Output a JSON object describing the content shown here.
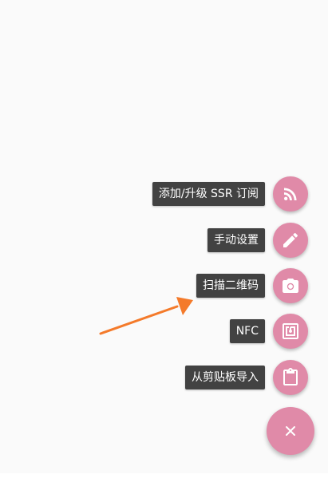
{
  "menu": {
    "items": [
      {
        "label": "添加/升级 SSR 订阅",
        "icon": "rss-icon"
      },
      {
        "label": "手动设置",
        "icon": "pencil-icon"
      },
      {
        "label": "扫描二维码",
        "icon": "camera-icon"
      },
      {
        "label": "NFC",
        "icon": "nfc-icon"
      },
      {
        "label": "从剪贴板导入",
        "icon": "clipboard-icon"
      }
    ]
  },
  "fab": {
    "icon": "close-icon"
  },
  "colors": {
    "accent": "#e08aa8",
    "label_bg": "#424242",
    "annotation_arrow": "#f47a2a"
  }
}
